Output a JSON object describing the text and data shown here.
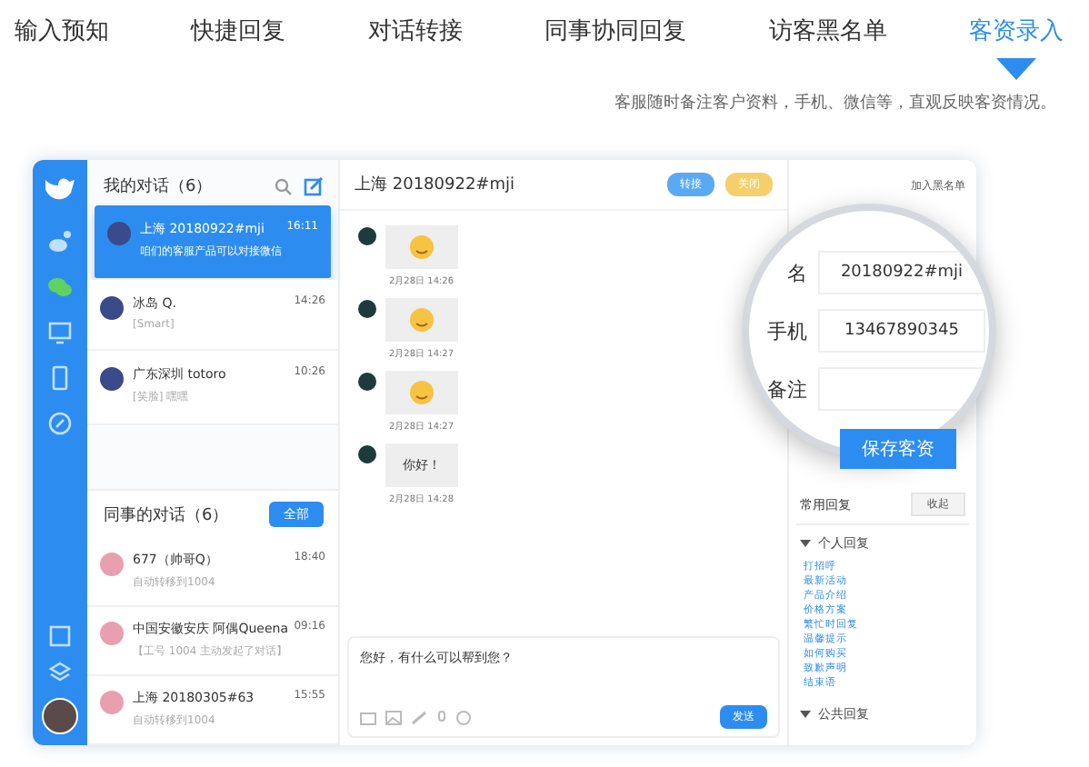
{
  "tabs": [
    {
      "label": "输入预知",
      "selected": false
    },
    {
      "label": "快捷回复",
      "selected": false
    },
    {
      "label": "对话转接",
      "selected": false
    },
    {
      "label": "同事协同回复",
      "selected": false
    },
    {
      "label": "访客黑名单",
      "selected": false
    },
    {
      "label": "客资录入",
      "selected": true
    }
  ],
  "subtitle": "客服随时备注客户资料，手机、微信等，直观反映客资情况。",
  "nav": {
    "items": [
      {
        "kind": "weibo",
        "selected": false
      },
      {
        "kind": "wechat",
        "selected": true
      },
      {
        "kind": "monitor",
        "selected": false
      },
      {
        "kind": "phone",
        "selected": false
      },
      {
        "kind": "compass",
        "selected": false
      }
    ]
  },
  "my_chats": {
    "title": "我的对话（6）",
    "items": [
      {
        "name": "上海 20180922#mji",
        "time": "16:11",
        "preview": "咱们的客服产品可以对接微信",
        "selected": true
      },
      {
        "name": "冰岛 Q.",
        "time": "14:26",
        "preview": "[Smart]",
        "selected": false
      },
      {
        "name": "广东深圳 totoro",
        "time": "10:26",
        "preview": "[笑脸] 嘿嘿",
        "selected": false
      }
    ]
  },
  "colleague_chats": {
    "title": "同事的对话（6）",
    "button": "全部",
    "items": [
      {
        "name": "677（帅哥Q）",
        "time": "18:40",
        "preview": "自动转移到1004"
      },
      {
        "name": "中国安徽安庆 阿偶Queena",
        "time": "09:16",
        "preview": "【工号 1004 主动发起了对话】"
      },
      {
        "name": "上海 20180305#63",
        "time": "15:55",
        "preview": "自动转移到1004"
      }
    ]
  },
  "chat": {
    "title": "上海 20180922#mji",
    "buttons": [
      {
        "label": "转接",
        "kind": "primary"
      },
      {
        "label": "关闭",
        "kind": "warning"
      }
    ],
    "messages": [
      {
        "kind": "emoji",
        "time": "2月28日 14:26"
      },
      {
        "kind": "emoji",
        "time": "2月28日 14:27"
      },
      {
        "kind": "emoji",
        "time": "2月28日 14:27"
      },
      {
        "kind": "text",
        "text": "你好！",
        "time": "2月28日 14:28"
      }
    ],
    "input": {
      "value": "您好，有什么可以帮到您？"
    },
    "send": "发送"
  },
  "right_panel": {
    "header": "加入黑名单",
    "fields": [
      {
        "label": "名",
        "value": "20180922#mji"
      },
      {
        "label": "手机",
        "value": "13467890345"
      },
      {
        "label": "备注"
      }
    ],
    "save": "保存客资",
    "quick_replies": {
      "title": "常用回复",
      "collapse": "收起",
      "groups": [
        {
          "title": "个人回复",
          "expanded": true,
          "items": [
            "打招呼",
            "最新活动",
            "产品介绍",
            "价格方案",
            "繁忙时回复",
            "温馨提示",
            "如何购买",
            "致歉声明",
            "结束语"
          ]
        },
        {
          "title": "公共回复",
          "expanded": true
        }
      ]
    }
  }
}
